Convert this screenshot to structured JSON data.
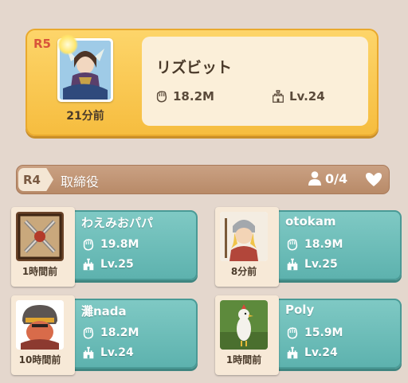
{
  "leader": {
    "rank": "R5",
    "name": "リズビット",
    "power": "18.2M",
    "level": "Lv.24",
    "last_seen": "21分前",
    "accent": "#f6bd3f"
  },
  "r4_group": {
    "rank": "R4",
    "title": "取締役",
    "count": "0/4"
  },
  "members": [
    {
      "name": "わえみおパパ",
      "power": "19.8M",
      "level": "Lv.25",
      "last_seen": "1時間前"
    },
    {
      "name": "otokam",
      "power": "18.9M",
      "level": "Lv.25",
      "last_seen": "8分前"
    },
    {
      "name": "灘nada",
      "power": "18.2M",
      "level": "Lv.24",
      "last_seen": "10時間前"
    },
    {
      "name": "Poly",
      "power": "15.9M",
      "level": "Lv.24",
      "last_seen": "1時間前"
    }
  ],
  "icons": {
    "power": "fist-icon",
    "level": "castle-icon",
    "members": "person-icon",
    "collapse": "heart-chevron-icon"
  },
  "colors": {
    "member_card": "#6fbdb8",
    "rank_bar": "#c09476",
    "background": "#e4d7cd"
  }
}
